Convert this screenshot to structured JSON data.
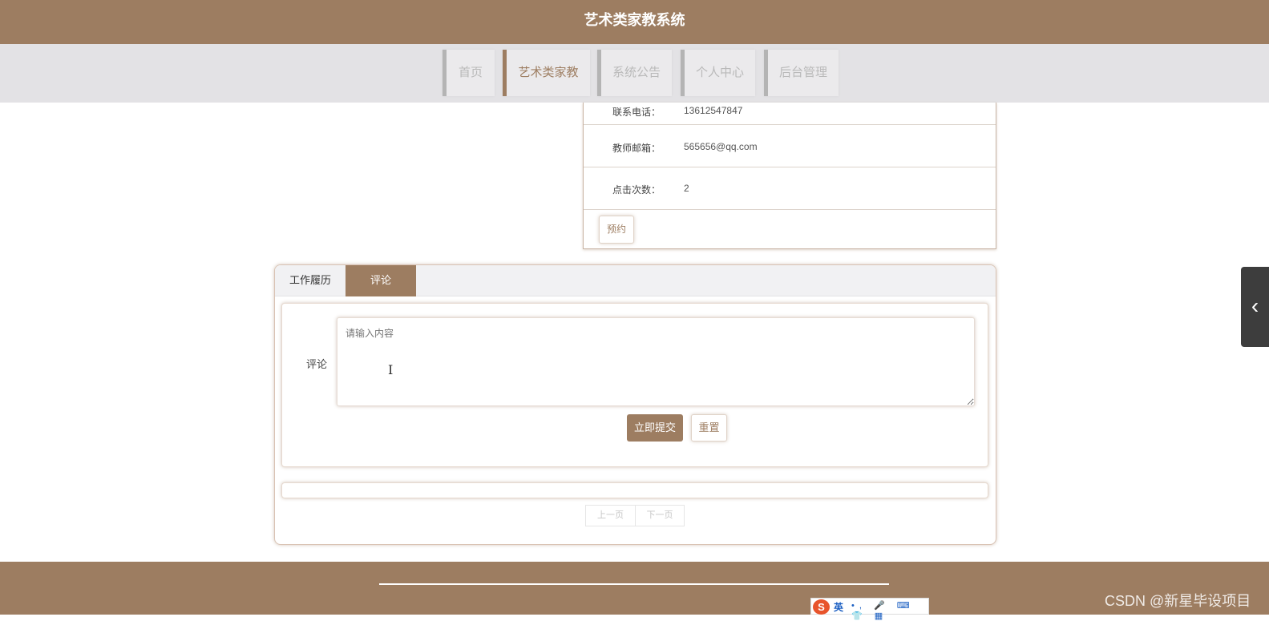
{
  "header": {
    "title": "艺术类家教系统"
  },
  "nav": {
    "items": [
      {
        "label": "首页",
        "active": false
      },
      {
        "label": "艺术类家教",
        "active": true
      },
      {
        "label": "系统公告",
        "active": false
      },
      {
        "label": "个人中心",
        "active": false
      },
      {
        "label": "后台管理",
        "active": false
      }
    ]
  },
  "detail": {
    "rows": [
      {
        "label": "联系电话：",
        "value": "13612547847"
      },
      {
        "label": "教师邮箱：",
        "value": "565656@qq.com"
      },
      {
        "label": "点击次数：",
        "value": "2"
      }
    ],
    "book_label": "预约"
  },
  "tabs": [
    {
      "label": "工作履历",
      "active": false
    },
    {
      "label": "评论",
      "active": true
    }
  ],
  "comment_form": {
    "label": "评论",
    "placeholder": "请输入内容",
    "value": "",
    "submit_label": "立即提交",
    "reset_label": "重置"
  },
  "pager": {
    "prev_label": "上一页",
    "next_label": "下一页"
  },
  "side_tab": {
    "icon": "chevron-left-icon"
  },
  "ime": {
    "logo": "S",
    "lang": "英",
    "icons": "•, 🎤 ⌨ 👕 ▦"
  },
  "watermark": "CSDN @新星毕设项目",
  "colors": {
    "brand": "#9d7d61",
    "nav_bg": "#e3e2e5",
    "side_tab": "#3d3d3d"
  }
}
